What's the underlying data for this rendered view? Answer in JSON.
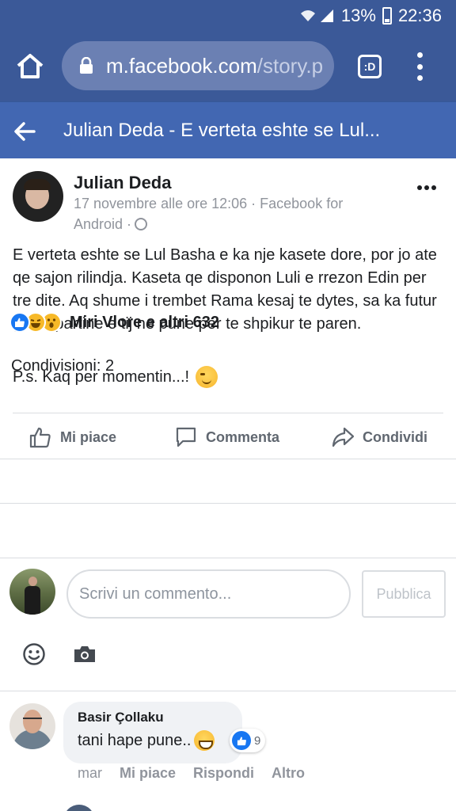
{
  "status_bar": {
    "battery": "13%",
    "time": "22:36"
  },
  "browser": {
    "url_main": "m.facebook.com",
    "url_rest": "/story.p",
    "tabs_label": ":D"
  },
  "header": {
    "title": "Julian Deda - E verteta eshte se Lul..."
  },
  "post": {
    "author": "Julian Deda",
    "meta": "17 novembre alle ore 12:06 · Facebook for Android ·",
    "text": "E verteta eshte se Lul Basha e ka nje kasete dore, por jo ate qe sajon rilindja. Kaseta qe disponon Luli e rrezon Edin per tre dite. Aq shume i trembet Rama kesaj te dytes, sa ka futur gjithe partine e tij ne pune per te shpikur te paren.",
    "ps": "P.s. Kaq per momentin...!"
  },
  "actions": {
    "like": "Mi piace",
    "comment": "Commenta",
    "share": "Condividi"
  },
  "reactions": {
    "summary": "Miri Vlore e altri 632"
  },
  "shares": {
    "label": "Condivisioni: 2"
  },
  "composer": {
    "placeholder": "Scrivi un commento...",
    "publish": "Pubblica"
  },
  "comment": {
    "author": "Basir Çollaku",
    "text": "tani hape pune..",
    "reaction_count": "9",
    "time": "mar",
    "like": "Mi piace",
    "reply": "Rispondi",
    "more": "Altro"
  },
  "colors": {
    "browser_blue": "#3b5998",
    "facebook_blue": "#4267b2",
    "like_blue": "#1877f2"
  }
}
